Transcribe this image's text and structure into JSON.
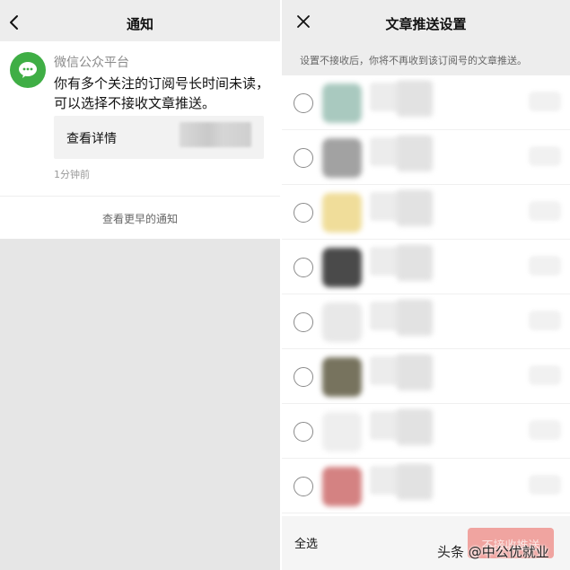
{
  "left": {
    "header": {
      "title": "通知"
    },
    "card": {
      "sender": "微信公众平台",
      "message": "你有多个关注的订阅号长时间未读，可以选择不接收文章推送。",
      "detail_label": "查看详情",
      "time": "1分钟前"
    },
    "more_label": "查看更早的通知",
    "colors": {
      "avatar": "#3fae45"
    }
  },
  "right": {
    "header": {
      "title": "文章推送设置"
    },
    "hint": "设置不接收后，你将不再收到该订阅号的文章推送。",
    "items": [
      {
        "avatar_color": "#a9c9bf",
        "selected": false
      },
      {
        "avatar_color": "#a2a2a2",
        "selected": false
      },
      {
        "avatar_color": "#f0dd9a",
        "selected": false
      },
      {
        "avatar_color": "#4a4a4a",
        "selected": false
      },
      {
        "avatar_color": "#e8e8e8",
        "selected": false
      },
      {
        "avatar_color": "#77735e",
        "selected": false
      },
      {
        "avatar_color": "#eeeeee",
        "selected": false
      },
      {
        "avatar_color": "#d48282",
        "selected": false
      }
    ],
    "footer": {
      "select_all": "全选",
      "unsubscribe_label": "不接收推送"
    },
    "colors": {
      "button": "#f0a4a0"
    }
  },
  "watermark": "头条 @中公优就业"
}
